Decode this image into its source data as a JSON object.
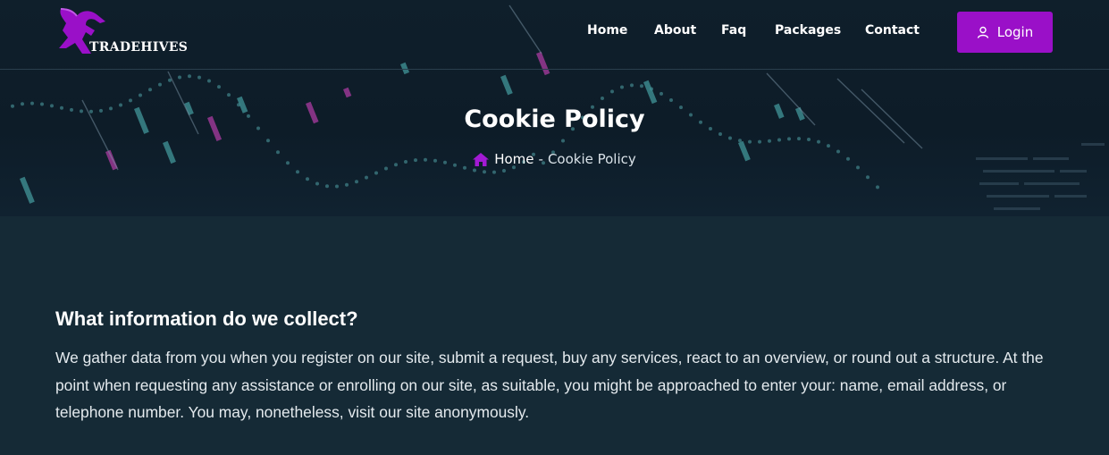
{
  "brand": {
    "name": "TRADEHIVES",
    "accent_color": "#9a10c8"
  },
  "nav": {
    "items": [
      {
        "label": "Home"
      },
      {
        "label": "About"
      },
      {
        "label": "Faq"
      },
      {
        "label": "Packages"
      },
      {
        "label": "Contact"
      }
    ],
    "login": {
      "label": "Login",
      "icon": "user-icon"
    }
  },
  "hero": {
    "title": "Cookie Policy",
    "breadcrumb": {
      "home_label": "Home",
      "home_icon": "home-icon",
      "separator": "-",
      "current": "Cookie Policy"
    }
  },
  "section": {
    "heading": "What information do we collect?",
    "body": "We gather data from you when you register on our site, submit a request, buy any services, react to an overview, or round out a structure. At the point when requesting any assistance or enrolling on our site, as suitable, you might be approached to enter your: name, email address, or telephone number. You may, nonetheless, visit our site anonymously."
  }
}
